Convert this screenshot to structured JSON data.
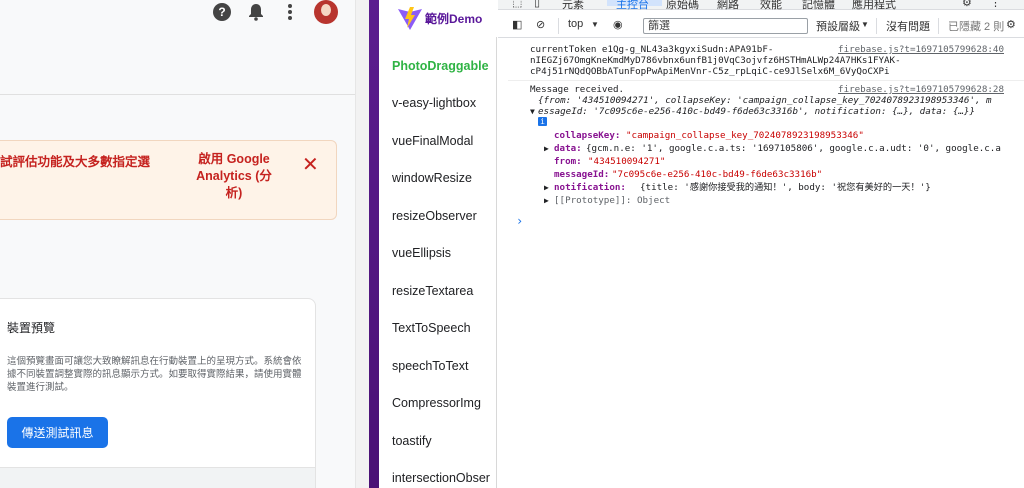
{
  "firebase": {
    "banner_text": "試評估功能及大多數指定選",
    "banner_button": "啟用 Google Analytics (分析)",
    "card_title": "裝置預覽",
    "card_desc": "這個預覽畫面可讓您大致瞭解訊息在行動裝置上的呈現方式。系統會依據不同裝置調整實際的訊息顯示方式。如要取得實際結果，請使用實體裝置進行測試。",
    "send_test_button": "傳送測試訊息"
  },
  "demo": {
    "title": "範例Demo",
    "items": [
      "PhotoDraggable",
      "v-easy-lightbox",
      "vueFinalModal",
      "windowResize",
      "resizeObserver",
      "vueEllipsis",
      "resizeTextarea",
      "TextToSpeech",
      "speechToText",
      "CompressorImg",
      "toastify",
      "intersectionObser"
    ]
  },
  "devtools": {
    "tabs": [
      "元素",
      "主控台",
      "原始碼",
      "網路",
      "效能",
      "記憶體",
      "應用程式"
    ],
    "context": "top",
    "filter_placeholder": "篩選",
    "levels": "預設層級",
    "issues": "沒有問題",
    "hidden": "已隱藏 2 則",
    "log1": {
      "line1": "currentToken e1Qg-g_NL43a3kgyxiSudn:APA91bF-",
      "line2": "nIEGZj67OmgKneKmdMyD786vbnx6unfB1j0VqC3ojvfz6HSTHmALWp24A7HKs1FYAK-",
      "line3": "cP4j51rNQdQOBbATunFopPwApiMenVnr-C5z_rpLqiC-ce9JlSelx6M_6VyQoCXPi",
      "source": "firebase.js?t=1697105799628:40"
    },
    "log2": {
      "line1": "Message received.",
      "source": "firebase.js?t=1697105799628:28",
      "summary": "{from: '434510094271', collapseKey: 'campaign_collapse_key_7024078923198953346', m",
      "message_id_line": "essageId: '7c095c6e-e256-410c-bd49-f6de63c3316b', notification: {…}, data: {…}}",
      "collapse_key_label": "collapseKey: ",
      "collapse_key_value": "\"campaign_collapse_key_7024078923198953346\"",
      "data_label": "data: ",
      "data_value": "{gcm.n.e: '1', google.c.a.ts: '1697105806', google.c.a.udt: '0', google.c.a",
      "from_label": "from: ",
      "from_value": "\"434510094271\"",
      "message_id_label": "messageId: ",
      "message_id_value": "\"7c095c6e-e256-410c-bd49-f6de63c3316b\"",
      "notification_label": "notification: ",
      "notification_value": "{title: '感謝你接受我的通知！', body: '祝您有美好的一天！'}",
      "prototype": "[[Prototype]]: Object"
    }
  }
}
